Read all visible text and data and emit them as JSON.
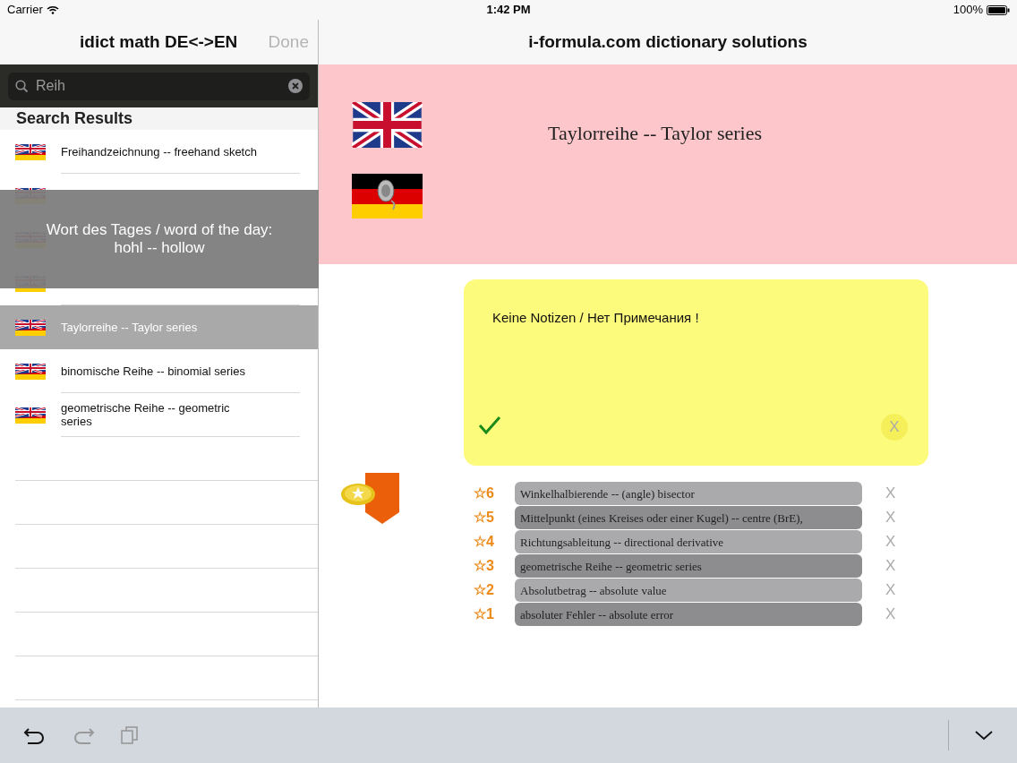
{
  "status_bar": {
    "carrier": "Carrier",
    "time": "1:42 PM",
    "battery": "100%"
  },
  "sidebar": {
    "title": "idict math DE<->EN",
    "done_button": "Done",
    "search": {
      "value": "Reih"
    },
    "section_header": "Search Results",
    "results": [
      {
        "kind": "entry",
        "text": "Freihandzeichnung -- freehand sketch",
        "selected": false
      },
      {
        "kind": "covered"
      },
      {
        "kind": "covered"
      },
      {
        "kind": "covered"
      },
      {
        "kind": "entry",
        "text": "Taylorreihe -- Taylor series",
        "selected": true
      },
      {
        "kind": "entry",
        "text": "binomische Reihe -- binomial series",
        "selected": false
      },
      {
        "kind": "entry",
        "text": "geometrische Reihe -- geometric series",
        "selected": false
      }
    ],
    "toast": {
      "line_1": "Wort des Tages / word of the day:",
      "line_2": "hohl -- hollow"
    }
  },
  "main": {
    "title": "i-formula.com dictionary solutions",
    "entry": "Taylorreihe -- Taylor series",
    "note": {
      "text": "Keine Notizen / Нет Примечания !",
      "close": "X"
    },
    "favorites": [
      {
        "label": "☆6",
        "text": "Winkelhalbierende -- (angle) bisector",
        "remove": "X"
      },
      {
        "label": "☆5",
        "text": "Mittelpunkt (eines Kreises oder einer Kugel) -- centre (BrE),",
        "remove": "X"
      },
      {
        "label": "☆4",
        "text": "Richtungsableitung -- directional derivative",
        "remove": "X"
      },
      {
        "label": "☆3",
        "text": "geometrische Reihe -- geometric series",
        "remove": "X"
      },
      {
        "label": "☆2",
        "text": "Absolutbetrag -- absolute value",
        "remove": "X"
      },
      {
        "label": "☆1",
        "text": "absoluter Fehler -- absolute error",
        "remove": "X"
      }
    ]
  }
}
